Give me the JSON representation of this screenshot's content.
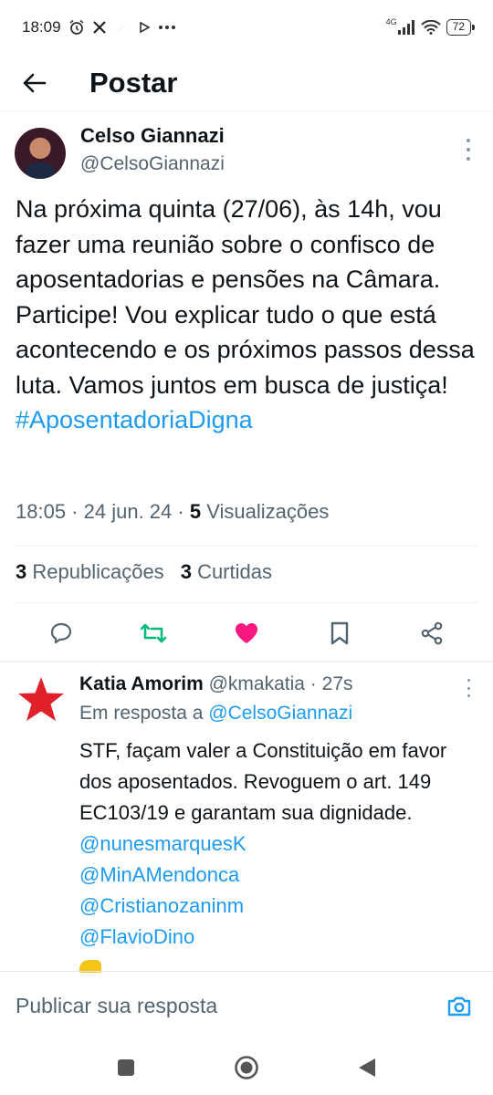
{
  "status_bar": {
    "time": "18:09",
    "network": "4G",
    "battery": "72"
  },
  "header": {
    "title": "Postar"
  },
  "tweet": {
    "author_name": "Celso Giannazi",
    "author_handle": "@CelsoGiannazi",
    "text": "Na próxima quinta (27/06), às 14h, vou fazer uma reunião sobre o confisco de aposentadorias e pensões na Câmara. Participe! Vou explicar tudo o que está acontecendo e os próximos passos dessa luta. Vamos juntos em busca de justiça! ",
    "hashtag": "#AposentadoriaDigna",
    "time": "18:05",
    "date": "24 jun. 24",
    "views_count": "5",
    "views_label": "Visualizações",
    "reposts_count": "3",
    "reposts_label": "Republicações",
    "likes_count": "3",
    "likes_label": "Curtidas"
  },
  "reply": {
    "author_name": "Katia Amorim",
    "author_handle": "@kmakatia",
    "age": "27s",
    "reply_to_prefix": "Em resposta a",
    "reply_to_handle": "@CelsoGiannazi",
    "text": "STF, façam valer a Constituição em favor dos aposentados. Revoguem o art. 149 EC103/19 e garantam sua dignidade. ",
    "mentions": [
      "@nunesmarquesK",
      "@MinAMendonca",
      "@Cristianozaninm",
      "@FlavioDino"
    ]
  },
  "reply_bar": {
    "placeholder": "Publicar sua resposta"
  },
  "colors": {
    "link": "#1d9bf0",
    "retweet_active": "#00ba7c",
    "like_active": "#f91880",
    "secondary_text": "#536471"
  },
  "icons": {
    "back": "arrow-left-icon",
    "reply": "comment-icon",
    "retweet": "retweet-icon",
    "like": "heart-icon",
    "bookmark": "bookmark-icon",
    "share": "share-icon",
    "camera": "camera-icon"
  }
}
